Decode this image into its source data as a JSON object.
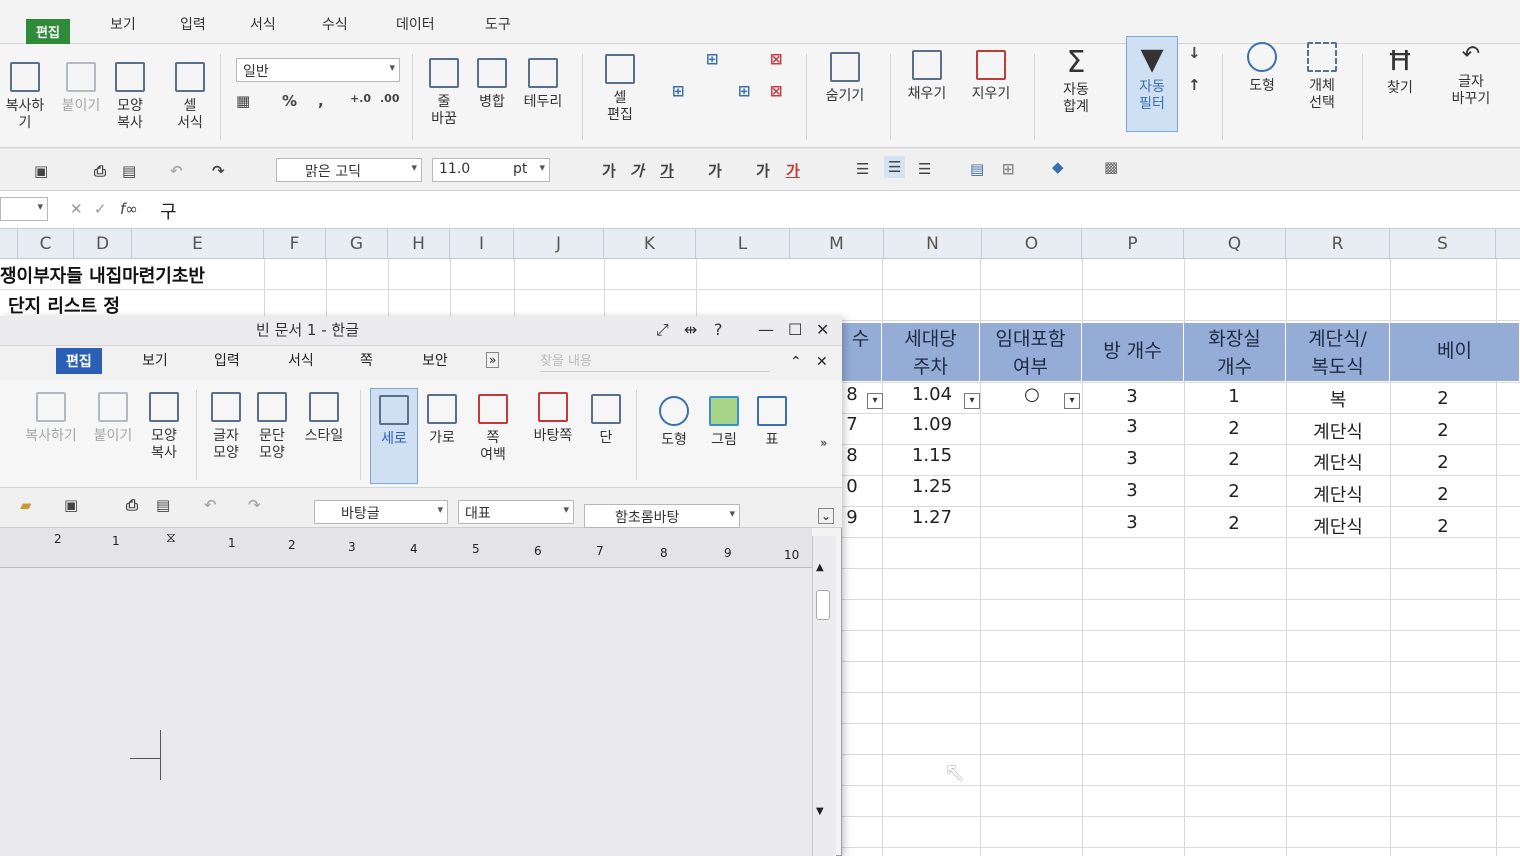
{
  "sheet": {
    "menu": [
      "편집",
      "보기",
      "입력",
      "서식",
      "수식",
      "데이터",
      "도구"
    ],
    "ribbon": [
      "복사하기",
      "붙이기",
      "모양\n복사",
      "셀\n서식",
      "줄\n바꿈",
      "병합",
      "테두리",
      "셀\n편집",
      "숨기기",
      "채우기",
      "지우기",
      "자동\n합계",
      "자동\n필터",
      "도형",
      "개체\n선택",
      "찾기",
      "글자\n바꾸기"
    ],
    "number_format": "일반",
    "font_name": "맑은 고딕",
    "font_size": "11.0",
    "font_unit": "pt",
    "formula": "구",
    "columns": [
      "C",
      "D",
      "E",
      "F",
      "G",
      "H",
      "I",
      "J",
      "K",
      "L",
      "M",
      "N",
      "O",
      "P",
      "Q",
      "R",
      "S"
    ],
    "title1": "쟁이부자들 내집마련기초반",
    "title2": "단지 리스트 정",
    "headers": [
      "수",
      "세대당\n주차",
      "임대포함\n여부",
      "방 개수",
      "화장실\n개수",
      "계단식/\n복도식",
      "베이"
    ],
    "rows": [
      {
        "m": "8",
        "n": "1.04",
        "o": "○",
        "p": "3",
        "q": "1",
        "r": "복",
        "s": "2"
      },
      {
        "m": "7",
        "n": "1.09",
        "o": "",
        "p": "3",
        "q": "2",
        "r": "계단식",
        "s": "2"
      },
      {
        "m": "8",
        "n": "1.15",
        "o": "",
        "p": "3",
        "q": "2",
        "r": "계단식",
        "s": "2"
      },
      {
        "m": "0",
        "n": "1.25",
        "o": "",
        "p": "3",
        "q": "2",
        "r": "계단식",
        "s": "2"
      },
      {
        "m": "9",
        "n": "1.27",
        "o": "",
        "p": "3",
        "q": "2",
        "r": "계단식",
        "s": "2"
      }
    ]
  },
  "hwp": {
    "title": "빈 문서 1 - 한글",
    "menu": [
      "편집",
      "보기",
      "입력",
      "서식",
      "쪽",
      "보안"
    ],
    "search_placeholder": "찾을 내용",
    "ribbon": [
      "복사하기",
      "붙이기",
      "모양\n복사",
      "글자\n모양",
      "문단\n모양",
      "스타일",
      "세로",
      "가로",
      "쪽\n여백",
      "바탕쪽",
      "단",
      "도형",
      "그림",
      "표"
    ],
    "style": "바탕글",
    "lang": "대표",
    "font": "함초롬바탕",
    "ruler": [
      "2",
      "1",
      "1",
      "2",
      "3",
      "4",
      "5",
      "6",
      "7",
      "8",
      "9",
      "10"
    ]
  },
  "colors": {
    "header_fill": "#94acd6",
    "active_tab": "#2f8a3a",
    "hwp_active_tab": "#2b5fb5"
  }
}
